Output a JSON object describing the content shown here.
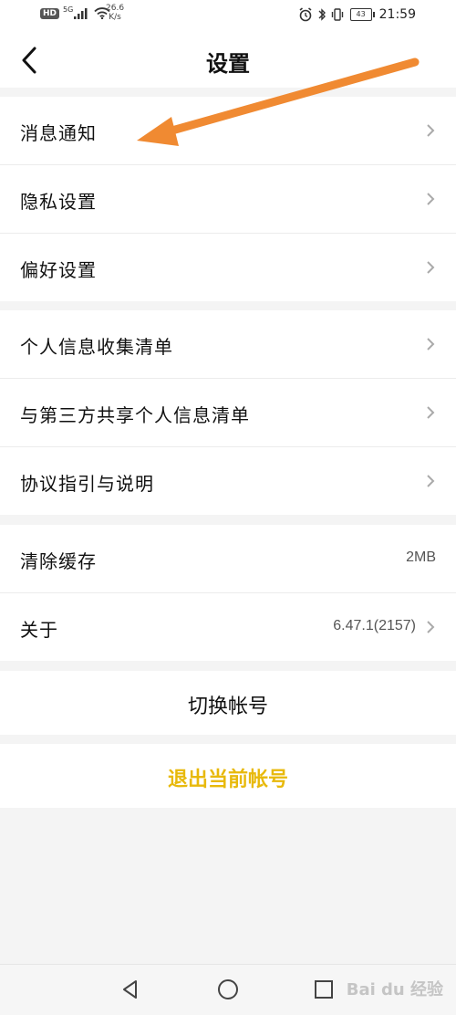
{
  "status_bar": {
    "hd": "HD",
    "network": "5G",
    "speed_value": "26.6",
    "speed_unit": "K/s",
    "battery": "43",
    "time": "21:59"
  },
  "header": {
    "title": "设置"
  },
  "groups": [
    {
      "items": [
        {
          "label": "消息通知"
        },
        {
          "label": "隐私设置"
        },
        {
          "label": "偏好设置"
        }
      ]
    },
    {
      "items": [
        {
          "label": "个人信息收集清单"
        },
        {
          "label": "与第三方共享个人信息清单"
        },
        {
          "label": "协议指引与说明"
        }
      ]
    },
    {
      "items": [
        {
          "label": "清除缓存",
          "value": "2MB"
        },
        {
          "label": "关于",
          "value": "6.47.1(2157)"
        }
      ]
    }
  ],
  "actions": {
    "switch_account": "切换帐号",
    "logout": "退出当前帐号"
  },
  "watermark": "Bai du 经验",
  "colors": {
    "accent_yellow": "#e8b90b",
    "annotation_arrow": "#f08a32",
    "background": "#f4f4f4"
  }
}
